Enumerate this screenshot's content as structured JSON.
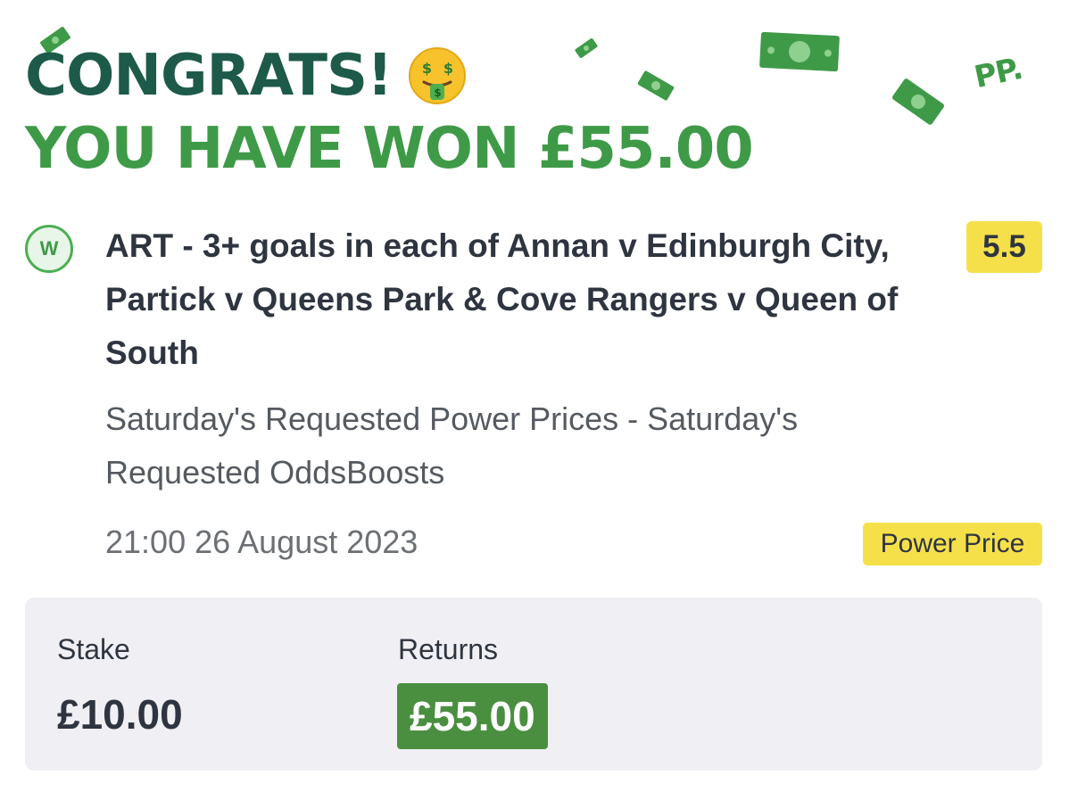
{
  "header": {
    "congrats_text": "CONGRATS!",
    "won_text": "YOU HAVE WON £55.00",
    "brand_logo": "PP."
  },
  "bet": {
    "result_badge": "W",
    "selection": "ART - 3+ goals in each of Annan v Edinburgh City, Partick v Queens Park & Cove Rangers v Queen of South",
    "odds": "5.5",
    "market": "Saturday's Requested Power Prices - Saturday's Requested OddsBoosts",
    "datetime": "21:00 26 August 2023",
    "promo_badge": "Power Price"
  },
  "summary": {
    "stake_label": "Stake",
    "stake_value": "£10.00",
    "returns_label": "Returns",
    "returns_value": "£55.00"
  },
  "colors": {
    "dark_green": "#1d5a4a",
    "brand_green": "#3f9a48",
    "highlight_yellow": "#f5e04a",
    "returns_green": "#4a8f3f",
    "panel_grey": "#f0f0f4",
    "text_dark": "#2f3540"
  },
  "icons": {
    "emoji": "money-mouth-face-icon",
    "decorations": "banknote-icon"
  }
}
